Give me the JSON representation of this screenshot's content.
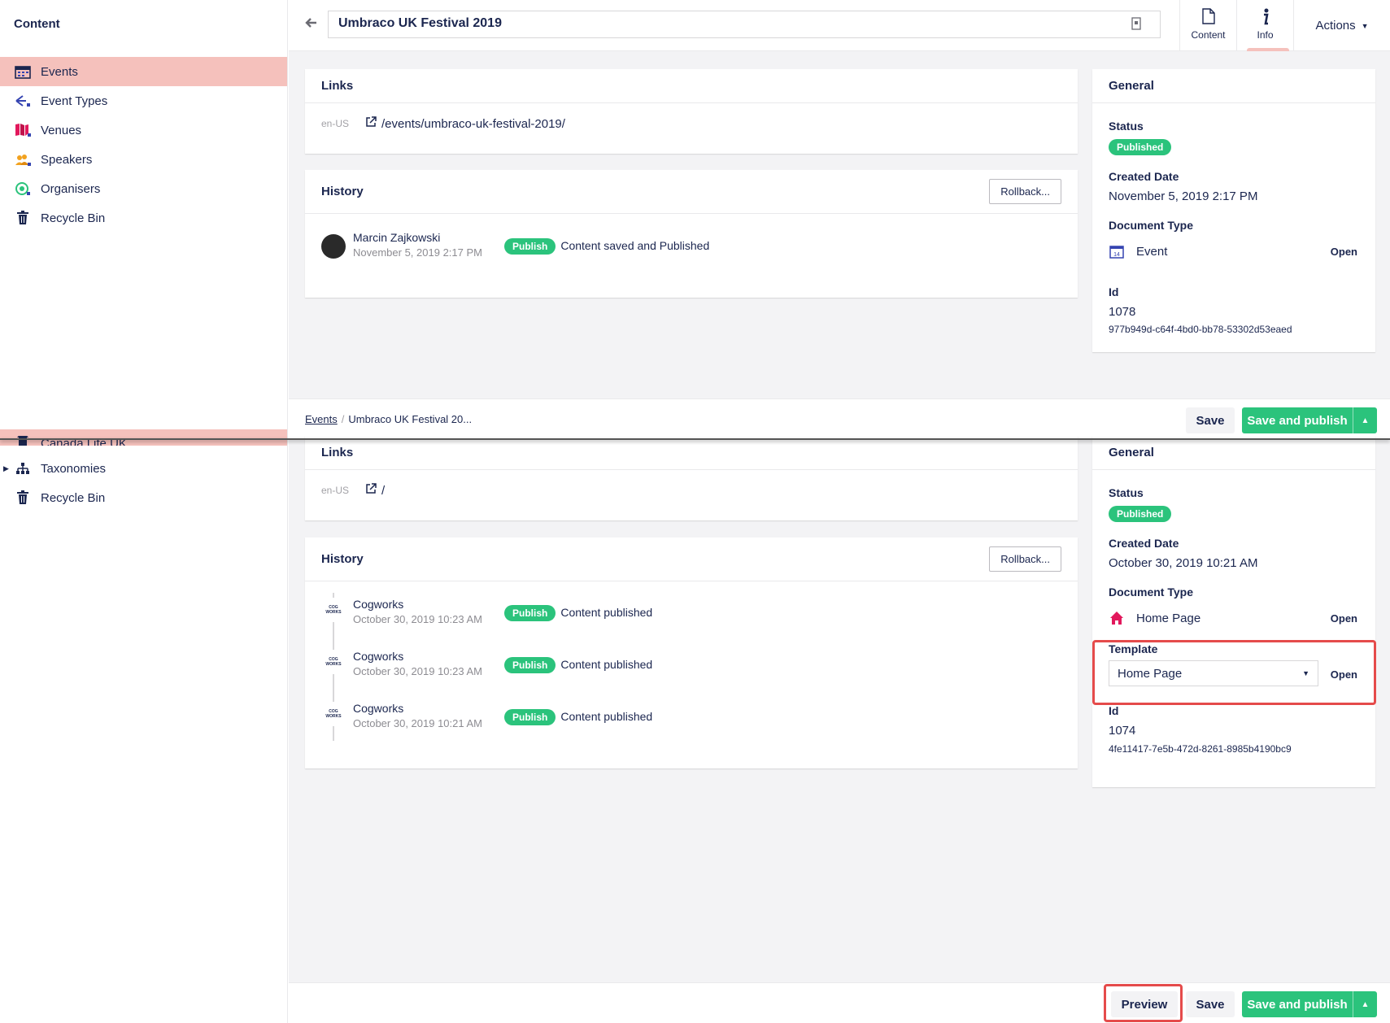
{
  "top": {
    "sidebar": {
      "title": "Content",
      "items": [
        {
          "label": "Events",
          "icon": "calendar-icon"
        },
        {
          "label": "Event Types",
          "icon": "branch-icon"
        },
        {
          "label": "Venues",
          "icon": "map-icon"
        },
        {
          "label": "Speakers",
          "icon": "users-icon"
        },
        {
          "label": "Organisers",
          "icon": "eye-icon"
        },
        {
          "label": "Recycle Bin",
          "icon": "trash-icon"
        }
      ]
    },
    "header": {
      "name": "Umbraco UK Festival 2019",
      "tabs": [
        {
          "label": "Content"
        },
        {
          "label": "Info"
        }
      ],
      "actions_label": "Actions"
    },
    "links": {
      "title": "Links",
      "culture": "en-US",
      "url": "/events/umbraco-uk-festival-2019/"
    },
    "history": {
      "title": "History",
      "rollback_label": "Rollback...",
      "entries": [
        {
          "name": "Marcin Zajkowski",
          "date": "November 5, 2019 2:17 PM",
          "badge": "Publish",
          "message": "Content saved and Published"
        }
      ]
    },
    "general": {
      "title": "General",
      "status_label": "Status",
      "status": "Published",
      "created_label": "Created Date",
      "created": "November 5, 2019 2:17 PM",
      "doctype_label": "Document Type",
      "doctype": "Event",
      "open_label": "Open",
      "id_label": "Id",
      "id": "1078",
      "guid": "977b949d-c64f-4bd0-bb78-53302d53eaed"
    },
    "footer": {
      "crumb_parent": "Events",
      "crumb_current": "Umbraco UK Festival 20...",
      "save_label": "Save",
      "publish_label": "Save and publish"
    }
  },
  "bottom": {
    "sidebar": {
      "partial_label": "Canada Life UK",
      "items": [
        {
          "label": "Taxonomies",
          "icon": "hierarchy-icon"
        },
        {
          "label": "Recycle Bin",
          "icon": "trash-icon"
        }
      ]
    },
    "links": {
      "title": "Links",
      "culture": "en-US",
      "url": "/"
    },
    "history": {
      "title": "History",
      "rollback_label": "Rollback...",
      "logo_text": "COG WORKS",
      "entries": [
        {
          "name": "Cogworks",
          "date": "October 30, 2019 10:23 AM",
          "badge": "Publish",
          "message": "Content published"
        },
        {
          "name": "Cogworks",
          "date": "October 30, 2019 10:23 AM",
          "badge": "Publish",
          "message": "Content published"
        },
        {
          "name": "Cogworks",
          "date": "October 30, 2019 10:21 AM",
          "badge": "Publish",
          "message": "Content published"
        }
      ]
    },
    "general": {
      "title": "General",
      "status_label": "Status",
      "status": "Published",
      "created_label": "Created Date",
      "created": "October 30, 2019 10:21 AM",
      "doctype_label": "Document Type",
      "doctype": "Home Page",
      "open_label": "Open",
      "template_label": "Template",
      "template_value": "Home Page",
      "template_open_label": "Open",
      "id_label": "Id",
      "id": "1074",
      "guid": "4fe11417-7e5b-472d-8261-8985b4190bc9"
    },
    "footer": {
      "preview_label": "Preview",
      "save_label": "Save",
      "publish_label": "Save and publish"
    }
  },
  "colors": {
    "accent_green": "#2bc37c",
    "active_pink": "#f5c1bc",
    "highlight_red": "#e54b4b",
    "text_navy": "#1b264f"
  }
}
